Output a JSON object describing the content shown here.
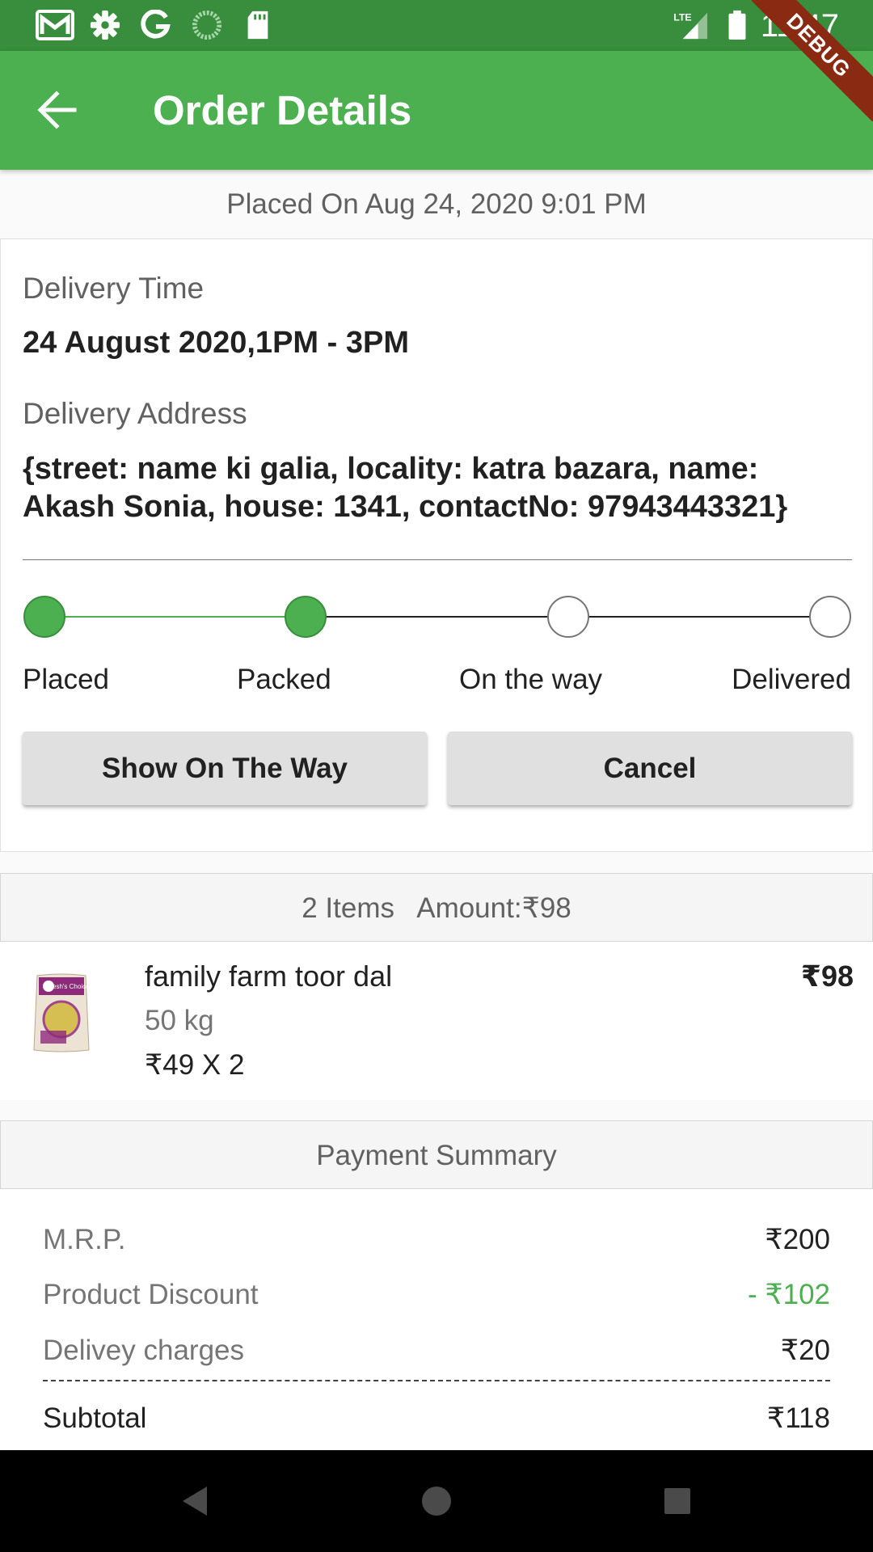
{
  "status_bar": {
    "time": "11:47",
    "network": "LTE",
    "icons": [
      "gmail-icon",
      "settings-gear-icon",
      "google-g-icon",
      "sync-progress-icon",
      "sd-card-icon",
      "signal-icon",
      "battery-icon"
    ]
  },
  "app_bar": {
    "title": "Order Details",
    "back_icon": "arrow-back-icon",
    "debug_banner": "DEBUG",
    "background_color": "#4caf50"
  },
  "order": {
    "placed_on": "Placed On Aug 24, 2020 9:01 PM",
    "delivery_time_label": "Delivery Time",
    "delivery_time": "24 August 2020,1PM - 3PM",
    "delivery_address_label": "Delivery Address",
    "delivery_address": "{street: name ki galia, locality: katra bazara, name: Akash Sonia, house: 1341, contactNo: 97943443321}"
  },
  "tracker": {
    "steps": [
      {
        "label": "Placed",
        "done": true
      },
      {
        "label": "Packed",
        "done": true
      },
      {
        "label": "On the way",
        "done": false
      },
      {
        "label": "Delivered",
        "done": false
      }
    ],
    "active_color": "#4caf50"
  },
  "actions": {
    "show_on_the_way": "Show On The Way",
    "cancel": "Cancel"
  },
  "items_summary": "2 Items   Amount:₹98",
  "items": [
    {
      "name": "family farm toor dal",
      "quantity": "50 kg",
      "unit_price": "₹49 X 2",
      "total": "₹98",
      "image_brand_text": "Fresh's Choice"
    }
  ],
  "payment": {
    "header": "Payment Summary",
    "mrp_label": "M.R.P.",
    "mrp": "₹200",
    "discount_label": "Product Discount",
    "discount": "- ₹102",
    "delivery_label": "Delivey charges",
    "delivery": "₹20",
    "subtotal_label": "Subtotal",
    "subtotal": "₹118",
    "discount_color": "#4caf50"
  },
  "nav_bar": {
    "icons": [
      "back-triangle-icon",
      "home-circle-icon",
      "recents-square-icon"
    ]
  }
}
